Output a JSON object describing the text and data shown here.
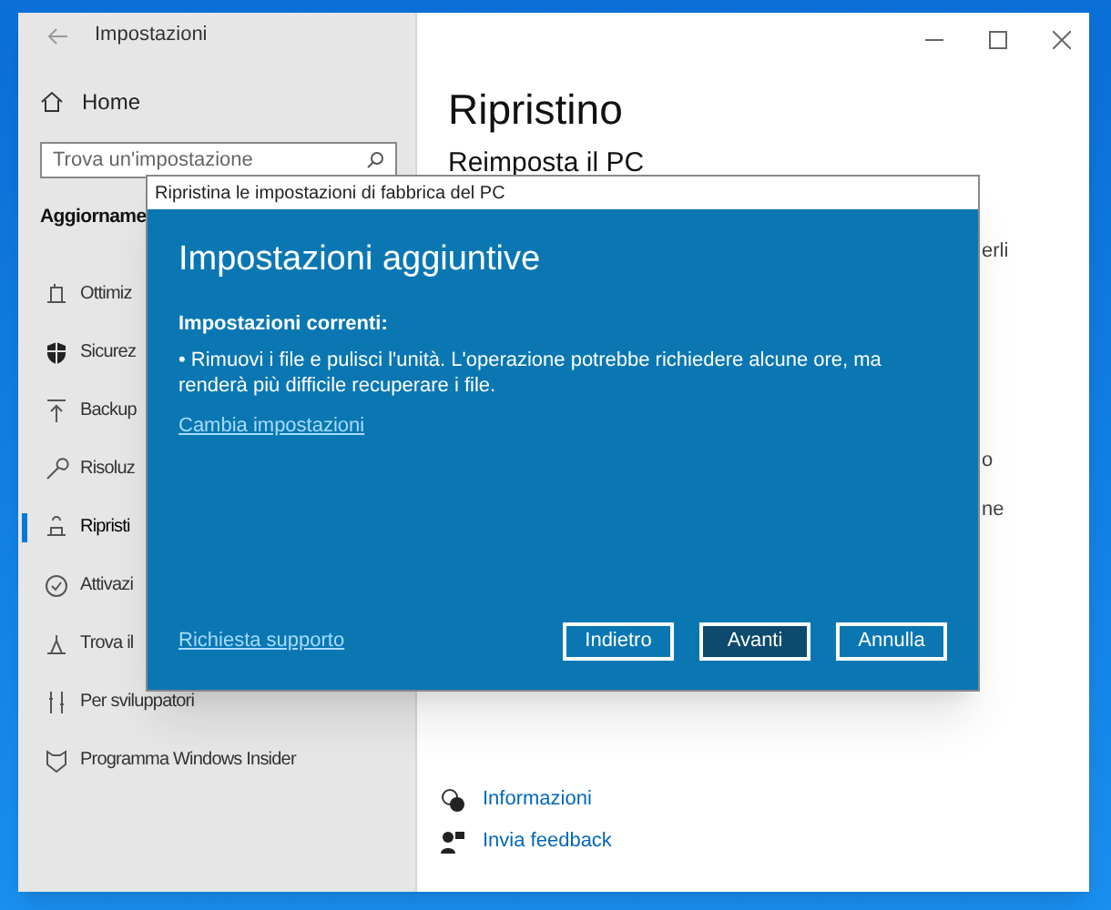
{
  "window": {
    "title": "Impostazioni"
  },
  "sidebar": {
    "home": "Home",
    "search": {
      "placeholder": "Trova un'impostazione"
    },
    "section": "Aggiorname",
    "items": [
      {
        "label": "Ottimiz",
        "selected": false
      },
      {
        "label": "Sicurez",
        "selected": false
      },
      {
        "label": "Backup",
        "selected": false
      },
      {
        "label": "Risoluz",
        "selected": false
      },
      {
        "label": "Ripristi",
        "selected": true
      },
      {
        "label": "Attivazi",
        "selected": false
      },
      {
        "label": "Trova il",
        "selected": false
      },
      {
        "label": "Per sviluppatori",
        "selected": false
      },
      {
        "label": "Programma Windows Insider",
        "selected": false
      }
    ]
  },
  "main": {
    "title": "Ripristino",
    "subtitle": "Reimposta il PC",
    "fragments": [
      "erli",
      "o",
      "ne"
    ],
    "links": [
      "Informazioni",
      "Invia feedback"
    ]
  },
  "dialog": {
    "title": "Ripristina le impostazioni di fabbrica del PC",
    "heading": "Impostazioni aggiuntive",
    "label": "Impostazioni correnti:",
    "bullet": "•  Rimuovi i file e pulisci l'unità. L'operazione potrebbe richiedere alcune ore, ma renderà più difficile recuperare i file.",
    "change_link": "Cambia impostazioni",
    "support_link": "Richiesta supporto",
    "buttons": [
      {
        "label": "Indietro",
        "default": false
      },
      {
        "label": "Avanti",
        "default": true
      },
      {
        "label": "Annulla",
        "default": false
      }
    ]
  }
}
